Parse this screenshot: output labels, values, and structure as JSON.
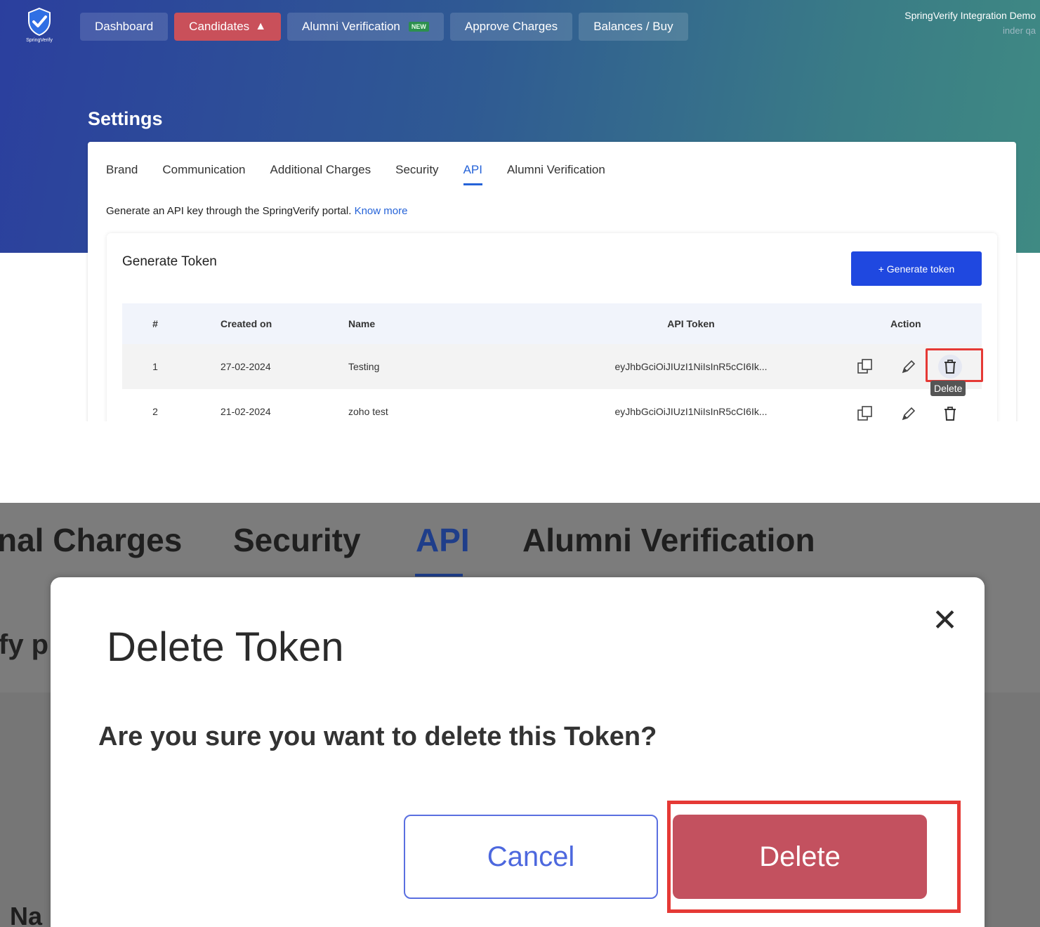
{
  "app": {
    "logo_text": "SpringVerify",
    "nav": [
      {
        "label": "Dashboard"
      },
      {
        "label": "Candidates",
        "icon": "warning-icon",
        "color": "#c9505a"
      },
      {
        "label": "Alumni Verification",
        "badge": "NEW"
      },
      {
        "label": "Approve Charges"
      },
      {
        "label": "Balances / Buy"
      }
    ],
    "account": {
      "name": "SpringVerify Integration Demo",
      "user": "inder qa"
    }
  },
  "settings": {
    "title": "Settings",
    "tabs": [
      {
        "label": "Brand"
      },
      {
        "label": "Communication"
      },
      {
        "label": "Additional Charges"
      },
      {
        "label": "Security"
      },
      {
        "label": "API",
        "active": true
      },
      {
        "label": "Alumni Verification"
      }
    ],
    "intro_text": "Generate an API key through the SpringVerify portal.",
    "intro_link": "Know more"
  },
  "token_section": {
    "title": "Generate Token",
    "generate_button": "+ Generate token",
    "columns": [
      "#",
      "Created on",
      "Name",
      "API Token",
      "Action"
    ],
    "rows": [
      {
        "num": "1",
        "created_on": "27-02-2024",
        "name": "Testing",
        "token": "eyJhbGciOiJIUzI1NiIsInR5cCI6Ik..."
      },
      {
        "num": "2",
        "created_on": "21-02-2024",
        "name": "zoho test",
        "token": "eyJhbGciOiJIUzI1NiIsInR5cCI6Ik..."
      }
    ],
    "tooltip": "Delete",
    "action_icons": [
      "copy-icon",
      "edit-icon",
      "trash-icon"
    ]
  },
  "zoomed": {
    "tabs": [
      "nal Charges",
      "Security",
      "API",
      "Alumni Verification"
    ],
    "fragment_left": "fy p",
    "fragment_bottom": "Na"
  },
  "modal": {
    "title": "Delete Token",
    "close_icon": "close-icon",
    "message": "Are you sure you want to delete this Token?",
    "cancel_label": "Cancel",
    "delete_label": "Delete",
    "delete_color": "#c3515f",
    "highlight_color": "#e53935"
  }
}
